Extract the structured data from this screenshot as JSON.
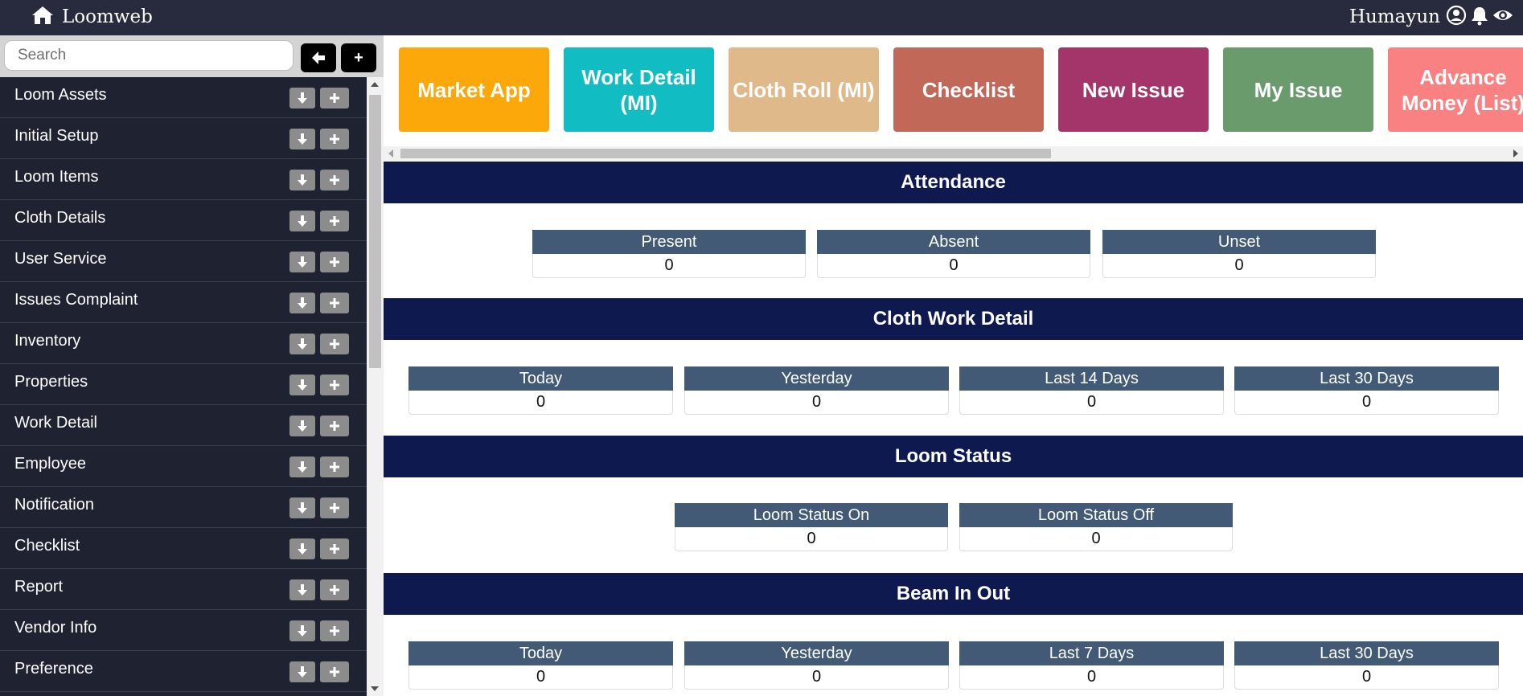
{
  "app": {
    "title": "Loomweb"
  },
  "user": {
    "name": "Humayun"
  },
  "sidebar": {
    "search_placeholder": "Search",
    "back_label": "🡐",
    "add_label": "+",
    "items": [
      {
        "label": "Loom Assets"
      },
      {
        "label": "Initial Setup"
      },
      {
        "label": "Loom Items"
      },
      {
        "label": "Cloth Details"
      },
      {
        "label": "User Service"
      },
      {
        "label": "Issues Complaint"
      },
      {
        "label": "Inventory"
      },
      {
        "label": "Properties"
      },
      {
        "label": "Work Detail"
      },
      {
        "label": "Employee"
      },
      {
        "label": "Notification"
      },
      {
        "label": "Checklist"
      },
      {
        "label": "Report"
      },
      {
        "label": "Vendor Info"
      },
      {
        "label": "Preference"
      }
    ]
  },
  "tiles": [
    {
      "label": "Market App",
      "color": "#fca80a"
    },
    {
      "label": "Work Detail (MI)",
      "color": "#11bdc2"
    },
    {
      "label": "Cloth Roll (MI)",
      "color": "#dfb98a"
    },
    {
      "label": "Checklist",
      "color": "#c16858"
    },
    {
      "label": "New Issue",
      "color": "#a3356b"
    },
    {
      "label": "My Issue",
      "color": "#6a9b6c"
    },
    {
      "label": "Advance Money (List)",
      "color": "#f98181"
    }
  ],
  "sections": {
    "attendance": {
      "title": "Attendance",
      "stats": [
        {
          "label": "Present",
          "value": "0"
        },
        {
          "label": "Absent",
          "value": "0"
        },
        {
          "label": "Unset",
          "value": "0"
        }
      ]
    },
    "cloth_work_detail": {
      "title": "Cloth Work Detail",
      "stats": [
        {
          "label": "Today",
          "value": "0"
        },
        {
          "label": "Yesterday",
          "value": "0"
        },
        {
          "label": "Last 14 Days",
          "value": "0"
        },
        {
          "label": "Last 30 Days",
          "value": "0"
        }
      ]
    },
    "loom_status": {
      "title": "Loom Status",
      "stats": [
        {
          "label": "Loom Status On",
          "value": "0"
        },
        {
          "label": "Loom Status Off",
          "value": "0"
        }
      ]
    },
    "beam_in_out": {
      "title": "Beam In Out",
      "stats": [
        {
          "label": "Today",
          "value": "0"
        },
        {
          "label": "Yesterday",
          "value": "0"
        },
        {
          "label": "Last 7 Days",
          "value": "0"
        },
        {
          "label": "Last 30 Days",
          "value": "0"
        }
      ]
    }
  },
  "colors": {
    "topbar": "#282b3d",
    "sidebar": "#1f2231",
    "section_header": "#0e1a4f",
    "stat_label": "#435a77"
  }
}
